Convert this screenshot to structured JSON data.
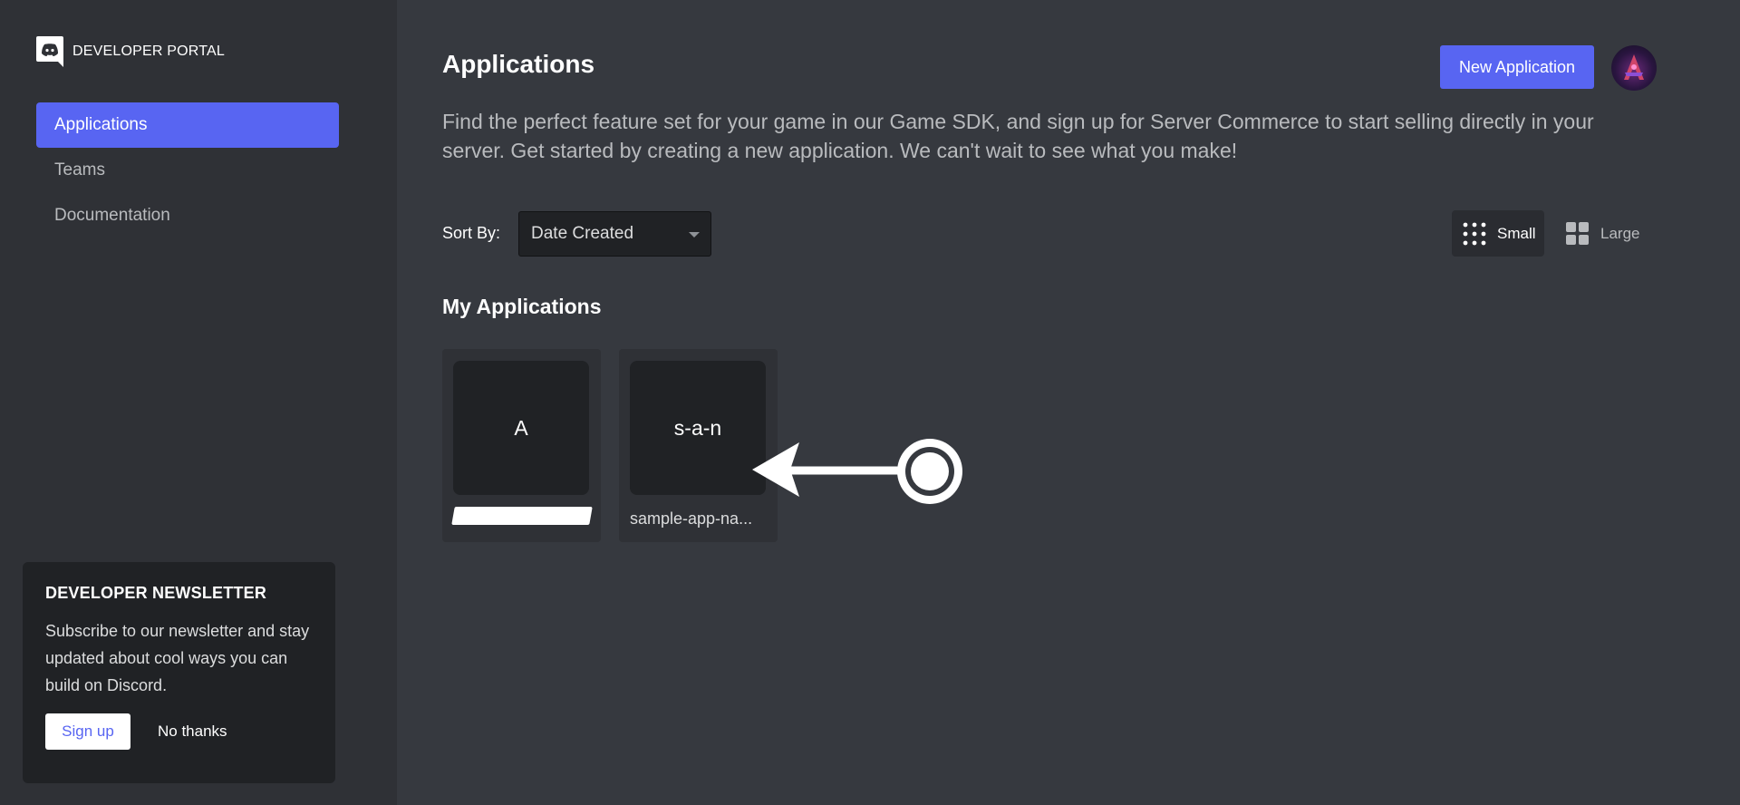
{
  "brand": {
    "title": "DEVELOPER PORTAL"
  },
  "sidebar": {
    "items": [
      {
        "label": "Applications",
        "active": true
      },
      {
        "label": "Teams",
        "active": false
      },
      {
        "label": "Documentation",
        "active": false
      }
    ]
  },
  "newsletter": {
    "title": "DEVELOPER NEWSLETTER",
    "body": "Subscribe to our newsletter and stay updated about cool ways you can build on Discord.",
    "signup_label": "Sign up",
    "nothanks_label": "No thanks"
  },
  "header": {
    "title": "Applications",
    "new_app_label": "New Application",
    "intro": "Find the perfect feature set for your game in our Game SDK, and sign up for Server Commerce to start selling directly in your server. Get started by creating a new application. We can't wait to see what you make!"
  },
  "sort": {
    "label": "Sort By:",
    "selected": "Date Created"
  },
  "view_toggle": {
    "small_label": "Small",
    "large_label": "Large",
    "selected": "Small"
  },
  "my_apps": {
    "title": "My Applications",
    "apps": [
      {
        "initials": "A",
        "name": ""
      },
      {
        "initials": "s-a-n",
        "name": "sample-app-na..."
      }
    ]
  },
  "colors": {
    "accent": "#5865f2",
    "background": "#36393f",
    "sidebar": "#2f3136",
    "card": "#202225"
  }
}
